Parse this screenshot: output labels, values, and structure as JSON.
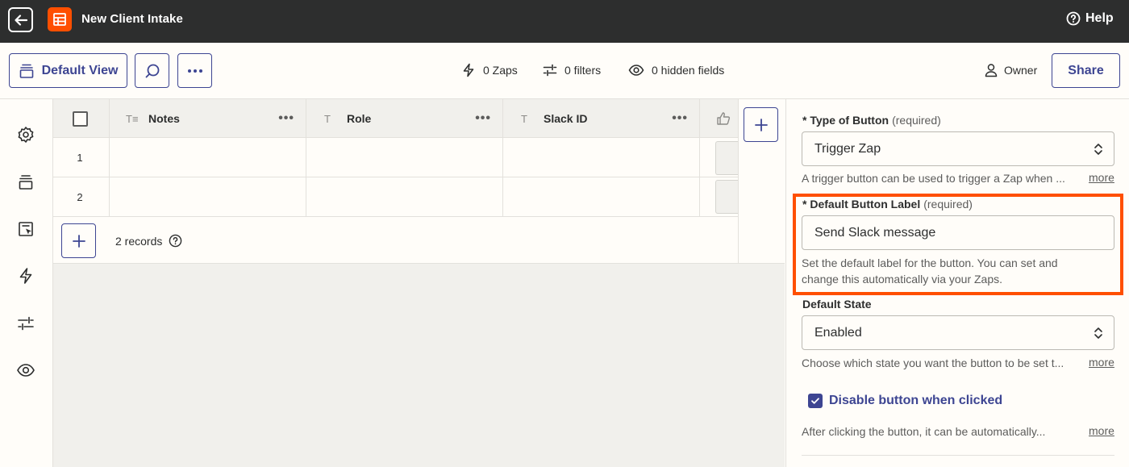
{
  "app": {
    "title": "New Client Intake",
    "help_label": "Help"
  },
  "toolbar": {
    "view_label": "Default View",
    "zaps": "0 Zaps",
    "filters": "0 filters",
    "hidden_fields": "0 hidden fields",
    "owner": "Owner",
    "share_label": "Share"
  },
  "rail_icons": [
    "settings-icon",
    "views-icon",
    "interfaces-icon",
    "zap-icon",
    "filter-icon",
    "eye-icon"
  ],
  "table": {
    "columns": [
      {
        "type": "long-text",
        "label": "Notes"
      },
      {
        "type": "text",
        "label": "Role"
      },
      {
        "type": "text",
        "label": "Slack ID"
      }
    ],
    "rows": [
      "1",
      "2"
    ],
    "records_label": "2 records"
  },
  "panel": {
    "type_of_button": {
      "label": "Type of Button",
      "required": "(required)",
      "value": "Trigger Zap",
      "help": "A trigger button can be used to trigger a Zap when ...",
      "more": "more"
    },
    "default_button_label": {
      "label": "Default Button Label",
      "required": "(required)",
      "value": "Send Slack message",
      "help_line1": "Set the default label for the button. You can set and",
      "help_line2": "change this automatically via your Zaps."
    },
    "default_state": {
      "label": "Default State",
      "value": "Enabled",
      "help": "Choose which state you want the button to be set t...",
      "more": "more"
    },
    "disable_when_clicked": {
      "label": "Disable button when clicked",
      "checked": true,
      "help": "After clicking the button, it can be automatically...",
      "more": "more"
    }
  },
  "colors": {
    "brand_orange": "#ff4f00",
    "accent_indigo": "#3d4592",
    "topbar": "#2d2e2e"
  }
}
